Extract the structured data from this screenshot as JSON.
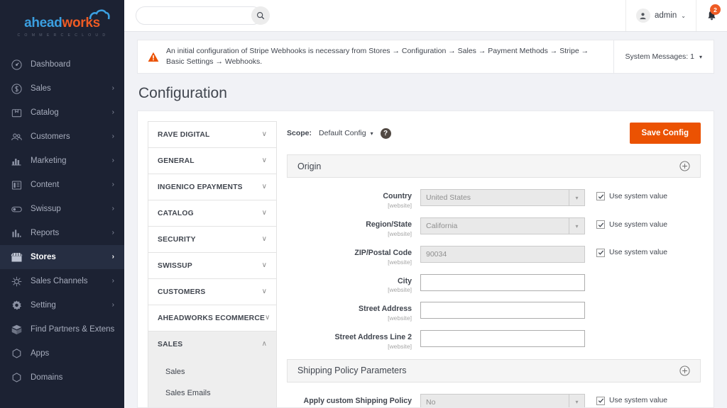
{
  "brand": {
    "name_part1": "ahead",
    "name_part2": "works",
    "tagline": "C O M M E R C E   C L O U D",
    "accent_blue": "#3b9fe0",
    "accent_orange": "#ee5b24"
  },
  "sidebar": {
    "items": [
      {
        "label": "Dashboard",
        "icon": "dashboard-icon",
        "arrow": "",
        "active": false
      },
      {
        "label": "Sales",
        "icon": "sales-dollar-icon",
        "arrow": "›",
        "active": false
      },
      {
        "label": "Catalog",
        "icon": "catalog-box-icon",
        "arrow": "›",
        "active": false
      },
      {
        "label": "Customers",
        "icon": "customers-icon",
        "arrow": "›",
        "active": false
      },
      {
        "label": "Marketing",
        "icon": "marketing-chart-icon",
        "arrow": "›",
        "active": false
      },
      {
        "label": "Content",
        "icon": "content-page-icon",
        "arrow": "›",
        "active": false
      },
      {
        "label": "Swissup",
        "icon": "swissup-toggle-icon",
        "arrow": "›",
        "active": false
      },
      {
        "label": "Reports",
        "icon": "reports-bars-icon",
        "arrow": "›",
        "active": false
      },
      {
        "label": "Stores",
        "icon": "stores-storefront-icon",
        "arrow": "›",
        "active": true
      },
      {
        "label": "Sales Channels",
        "icon": "sales-channels-icon",
        "arrow": "›",
        "active": false
      },
      {
        "label": "Setting",
        "icon": "gear-icon",
        "arrow": "›",
        "active": false
      },
      {
        "label": "Find Partners & Extensions",
        "icon": "extensions-box-icon",
        "arrow": "",
        "active": false
      },
      {
        "label": "Apps",
        "icon": "apps-hexagon-icon",
        "arrow": "",
        "active": false
      },
      {
        "label": "Domains",
        "icon": "domains-hexagon-icon",
        "arrow": "",
        "active": false
      }
    ]
  },
  "topbar": {
    "search_placeholder": "",
    "search_value": "",
    "search_icon": "search-icon",
    "admin_name": "admin",
    "admin_caret": "⌄",
    "bell_icon": "notification-bell-icon",
    "bell_badge": "2"
  },
  "message_bar": {
    "warning_icon": "warning-triangle-icon",
    "text": "An initial configuration of Stripe Webhooks is necessary from Stores → Configuration → Sales → Payment Methods → Stripe → Basic Settings → Webhooks.",
    "system_messages_label": "System Messages: 1",
    "system_messages_caret": "▾"
  },
  "page": {
    "title": "Configuration"
  },
  "config_nav": {
    "sections": [
      {
        "label": "RAVE DIGITAL",
        "open": false,
        "chevron": "∨"
      },
      {
        "label": "GENERAL",
        "open": false,
        "chevron": "∨"
      },
      {
        "label": "INGENICO EPAYMENTS",
        "open": false,
        "chevron": "∨"
      },
      {
        "label": "CATALOG",
        "open": false,
        "chevron": "∨"
      },
      {
        "label": "SECURITY",
        "open": false,
        "chevron": "∨"
      },
      {
        "label": "SWISSUP",
        "open": false,
        "chevron": "∨"
      },
      {
        "label": "CUSTOMERS",
        "open": false,
        "chevron": "∨"
      },
      {
        "label": "AHEADWORKS ECOMMERCE",
        "open": false,
        "chevron": "∨"
      },
      {
        "label": "SALES",
        "open": true,
        "chevron": "∧"
      }
    ],
    "sales_subitems": [
      {
        "label": "Sales"
      },
      {
        "label": "Sales Emails"
      }
    ]
  },
  "scope_bar": {
    "label": "Scope:",
    "value": "Default Config",
    "caret": "▾",
    "help_icon": "help-question-icon",
    "help_glyph": "?",
    "save_label": "Save Config",
    "save_color": "#eb5202"
  },
  "sections": [
    {
      "title": "Origin",
      "toggle_icon": "plus-circle-icon",
      "fields": [
        {
          "label": "Country",
          "scope": "[website]",
          "type": "select",
          "value": "United States",
          "disabled": true,
          "use_system_value": true,
          "use_system_label": "Use system value"
        },
        {
          "label": "Region/State",
          "scope": "[website]",
          "type": "select",
          "value": "California",
          "disabled": true,
          "use_system_value": true,
          "use_system_label": "Use system value"
        },
        {
          "label": "ZIP/Postal Code",
          "scope": "[website]",
          "type": "text",
          "value": "90034",
          "disabled": true,
          "use_system_value": true,
          "use_system_label": "Use system value"
        },
        {
          "label": "City",
          "scope": "[website]",
          "type": "text",
          "value": "",
          "disabled": false,
          "use_system_value": false,
          "use_system_label": ""
        },
        {
          "label": "Street Address",
          "scope": "[website]",
          "type": "text",
          "value": "",
          "disabled": false,
          "use_system_value": false,
          "use_system_label": ""
        },
        {
          "label": "Street Address Line 2",
          "scope": "[website]",
          "type": "text",
          "value": "",
          "disabled": false,
          "use_system_value": false,
          "use_system_label": ""
        }
      ]
    },
    {
      "title": "Shipping Policy Parameters",
      "toggle_icon": "plus-circle-icon",
      "fields": [
        {
          "label": "Apply custom Shipping Policy",
          "scope": "[website]",
          "type": "select",
          "value": "No",
          "disabled": true,
          "use_system_value": true,
          "use_system_label": "Use system value"
        }
      ]
    }
  ]
}
